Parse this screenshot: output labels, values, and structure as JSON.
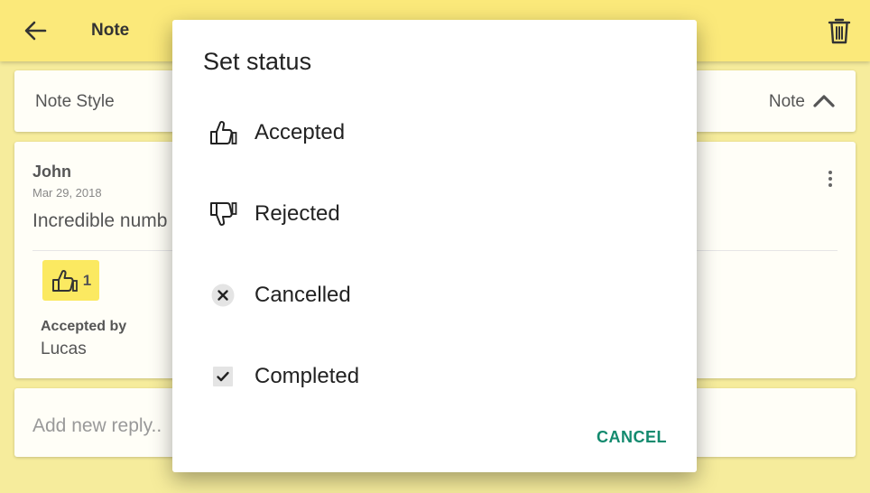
{
  "appbar": {
    "title": "Note",
    "back_icon": "arrow-back-icon",
    "delete_icon": "trash-icon"
  },
  "note_style": {
    "label": "Note Style",
    "value": "Note",
    "toggle_icon": "chevron-up-icon"
  },
  "note": {
    "author": "John",
    "date": "Mar 29, 2018",
    "text": "Incredible numb",
    "menu_icon": "more-vert-icon",
    "vote": {
      "icon": "thumbs-up-icon",
      "count": "1"
    },
    "accepted_by_label": "Accepted by",
    "accepted_by_name": "Lucas"
  },
  "reply": {
    "placeholder": "Add new reply.."
  },
  "dialog": {
    "title": "Set status",
    "options": [
      {
        "label": "Accepted",
        "icon": "thumbs-up-icon"
      },
      {
        "label": "Rejected",
        "icon": "thumbs-down-icon"
      },
      {
        "label": "Cancelled",
        "icon": "cancel-circle-icon"
      },
      {
        "label": "Completed",
        "icon": "checkbox-checked-icon"
      }
    ],
    "cancel_label": "CANCEL"
  },
  "colors": {
    "appbar": "#fbe97a",
    "background": "#f6ec9c",
    "vote_chip": "#fbe961",
    "accent": "#138a6e"
  }
}
